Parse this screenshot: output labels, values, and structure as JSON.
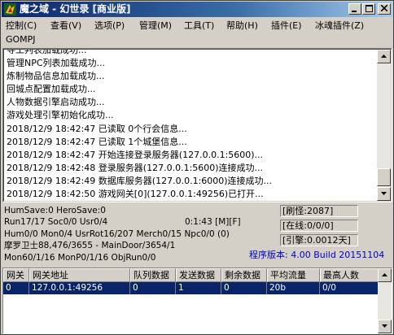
{
  "window": {
    "title": "魔之域 - 幻世录 [商业版]",
    "controls": {
      "minimize": "_",
      "maximize": "□",
      "close": "×"
    }
  },
  "menu": {
    "items": [
      {
        "label": "控制(C)"
      },
      {
        "label": "查看(V)"
      },
      {
        "label": "选项(P)"
      },
      {
        "label": "管理(M)"
      },
      {
        "label": "工具(T)"
      },
      {
        "label": "帮助(H)"
      },
      {
        "label": "插件(E)"
      },
      {
        "label": "冰魂插件(Z)"
      }
    ],
    "row2": [
      {
        "label": "GOMPJ"
      }
    ]
  },
  "log": {
    "lines": [
      "寻工判表加载成功...",
      "管理NPC列表加载成功...",
      "炼制物品信息加载成功...",
      "回城点配置加载成功...",
      "人物数据引擎启动成功...",
      "游戏处理引擎初始化成功...",
      "2018/12/9 18:42:47 已读取 0个行会信息...",
      "2018/12/9 18:42:47 已读取 1个城堡信息...",
      "2018/12/9 18:42:47 开始连接登录服务器(127.0.0.1:5600)...",
      "2018/12/9 18:42:48 登录服务器(127.0.0.1:5600)连接成功...",
      "2018/12/9 18:42:49 数据库服务器(127.0.0.1:6000)连接成功...",
      "2018/12/9 18:42:50 游戏网关[0](127.0.0.1:49256)已打开..."
    ]
  },
  "status": {
    "line1": "HumSave:0 HeroSave:0",
    "line2": "Run17/17 Soc0/0 Usr0/4",
    "line2_time": "0:1:43 [M][F]",
    "line3": "Hum0/0 Mon0/4 UsrRot16/207 Merch0/15 Npc0/0 (0)",
    "line4": "摩罗卫士88,476/3655 - MainDoor/3654/1",
    "line5": "Mon60/1/16 MonP0/1/16 ObjRun0/0",
    "refresh_monster": "[刷怪:2087]",
    "online": "[在线:0/0/0]",
    "engine": "[引擎:0.0012天]",
    "version": "程序版本: 4.00 Build 20151104"
  },
  "grid": {
    "columns": [
      "网关",
      "网关地址",
      "队列数据",
      "发送数据",
      "剩余数据",
      "平均流量",
      "最高人数"
    ],
    "rows": [
      [
        "0",
        "127.0.0.1:49256",
        "0",
        "1",
        "0",
        "20b",
        "0/0"
      ]
    ]
  },
  "colors": {
    "titlebar_start": "#0a246a",
    "selection": "#0a246a",
    "version_text": "#0000cc",
    "face": "#d4d0c8"
  }
}
